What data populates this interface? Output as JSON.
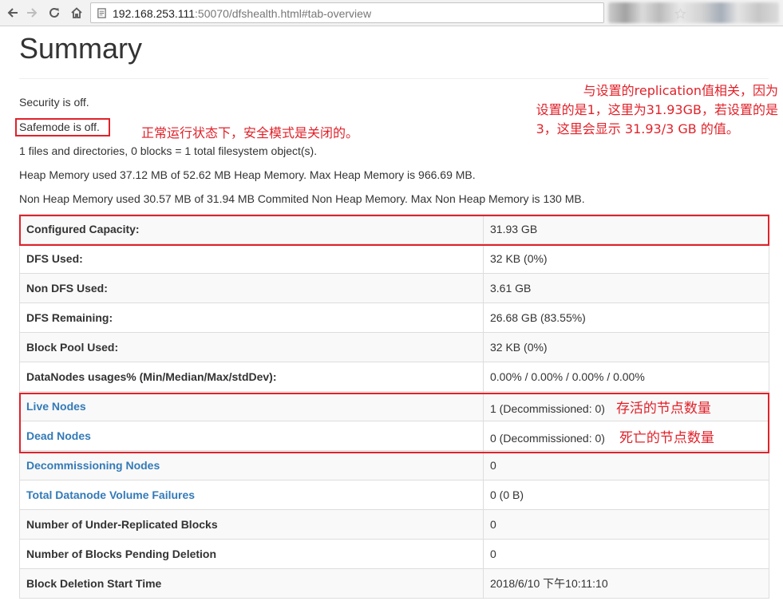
{
  "browser": {
    "url_host": "192.168.253.111",
    "url_rest": ":50070/dfshealth.html#tab-overview"
  },
  "page": {
    "title": "Summary",
    "security": "Security is off.",
    "safemode": "Safemode is off.",
    "fs_objects": "1 files and directories, 0 blocks = 1 total filesystem object(s).",
    "heap_memory": "Heap Memory used 37.12 MB of 52.62 MB Heap Memory. Max Heap Memory is 966.69 MB.",
    "non_heap_memory": "Non Heap Memory used 30.57 MB of 31.94 MB Commited Non Heap Memory. Max Non Heap Memory is 130 MB."
  },
  "annotations": {
    "safemode_note": "正常运行状态下，安全模式是关闭的。",
    "capacity_note_line1": "与设置的replication值相关，因为",
    "capacity_note_line2": "设置的是1，这里为31.93GB，若设置的是",
    "capacity_note_line3": "3，这里会显示 31.93/3 GB 的值。",
    "live_nodes_note": "存活的节点数量",
    "dead_nodes_note": "死亡的节点数量"
  },
  "table": {
    "rows": [
      {
        "label": "Configured Capacity:",
        "value": "31.93 GB"
      },
      {
        "label": "DFS Used:",
        "value": "32 KB (0%)"
      },
      {
        "label": "Non DFS Used:",
        "value": "3.61 GB"
      },
      {
        "label": "DFS Remaining:",
        "value": "26.68 GB (83.55%)"
      },
      {
        "label": "Block Pool Used:",
        "value": "32 KB (0%)"
      },
      {
        "label": "DataNodes usages% (Min/Median/Max/stdDev):",
        "value": "0.00% / 0.00% / 0.00% / 0.00%"
      },
      {
        "label": "Live Nodes",
        "value": "1 (Decommissioned: 0)"
      },
      {
        "label": "Dead Nodes",
        "value": "0 (Decommissioned: 0)"
      },
      {
        "label": "Decommissioning Nodes",
        "value": "0"
      },
      {
        "label": "Total Datanode Volume Failures",
        "value": "0 (0 B)"
      },
      {
        "label": "Number of Under-Replicated Blocks",
        "value": "0"
      },
      {
        "label": "Number of Blocks Pending Deletion",
        "value": "0"
      },
      {
        "label": "Block Deletion Start Time",
        "value": "2018/6/10 下午10:11:10"
      }
    ]
  },
  "colors": {
    "link": "#337ab7",
    "annotation_red": "#e0222a",
    "row_stripe": "#f9f9f9",
    "border": "#dddddd"
  },
  "icons": [
    "back-arrow-icon",
    "forward-arrow-icon",
    "reload-icon",
    "home-icon",
    "page-info-icon",
    "bookmark-star-icon"
  ]
}
